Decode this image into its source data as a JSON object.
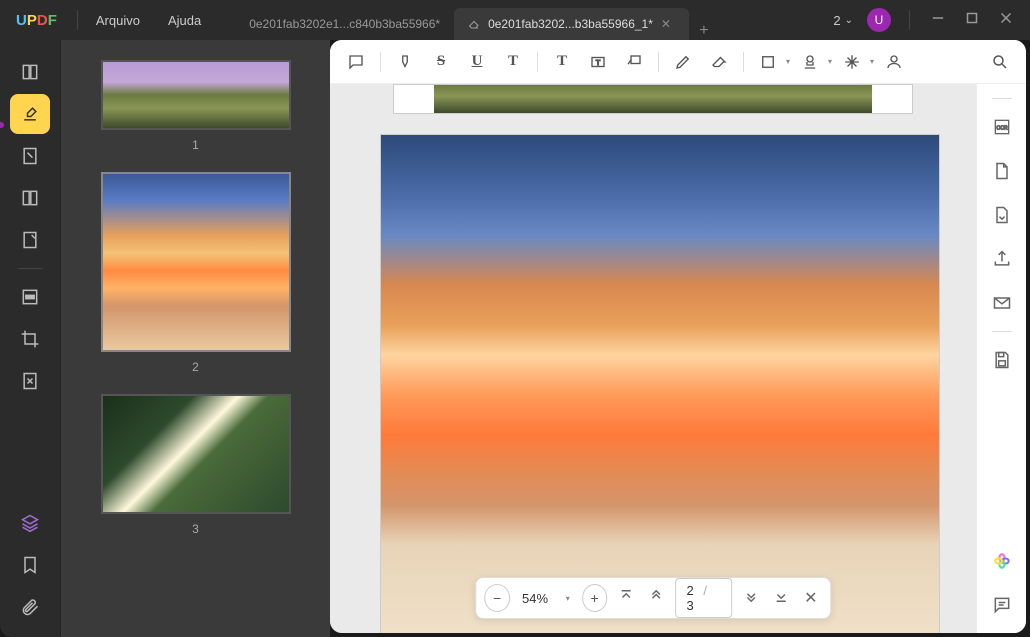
{
  "logo": {
    "u": "U",
    "p": "P",
    "d": "D",
    "f": "F"
  },
  "menu": {
    "file": "Arquivo",
    "help": "Ajuda"
  },
  "tabs": [
    {
      "label": "0e201fab3202e1...c840b3ba55966*"
    },
    {
      "label": "0e201fab3202...b3ba55966_1*"
    }
  ],
  "zoom": {
    "count": "2",
    "current": "2",
    "sep": "/",
    "total": "3",
    "level": "54%"
  },
  "avatar": "U",
  "thumbs": {
    "n1": "1",
    "n2": "2",
    "n3": "3"
  },
  "ocr": "OCR"
}
